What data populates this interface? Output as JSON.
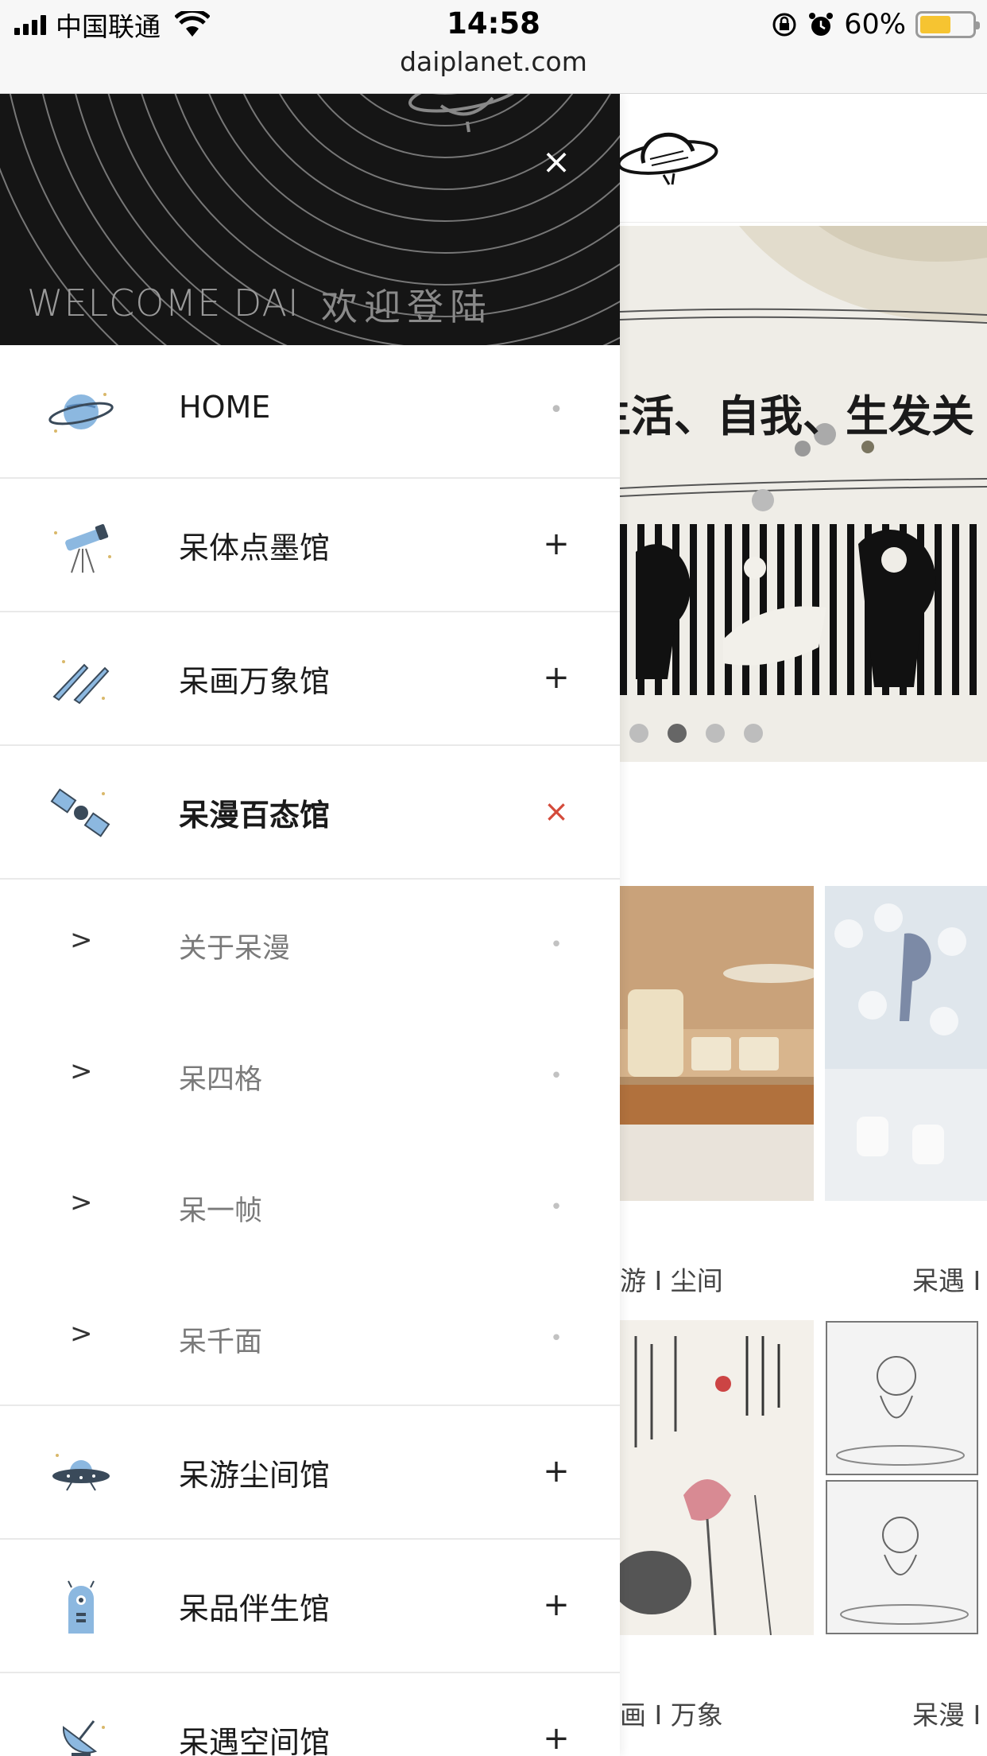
{
  "status_bar": {
    "carrier": "中国联通",
    "time": "14:58",
    "battery_percent": "60%",
    "battery_level": 0.6,
    "url": "daiplanet.com"
  },
  "drawer": {
    "welcome": "WELCOME DAI",
    "login": "欢迎登陆",
    "close_icon": "×",
    "items": [
      {
        "label": "HOME",
        "icon": "planet-icon",
        "action": "•"
      },
      {
        "label": "呆体点墨馆",
        "icon": "telescope-icon",
        "action": "+"
      },
      {
        "label": "呆画万象馆",
        "icon": "comet-icon",
        "action": "+"
      },
      {
        "label": "呆漫百态馆",
        "icon": "satellite-icon",
        "action": "×",
        "expanded": true
      },
      {
        "label": "呆游尘间馆",
        "icon": "ufo-icon",
        "action": "+"
      },
      {
        "label": "呆品伴生馆",
        "icon": "robot-icon",
        "action": "+"
      },
      {
        "label": "呆遇空间馆",
        "icon": "radar-dish-icon",
        "action": "+"
      }
    ],
    "subitems": [
      {
        "label": "关于呆漫",
        "chevron": ">",
        "action": "•"
      },
      {
        "label": "呆四格",
        "chevron": ">",
        "action": "•"
      },
      {
        "label": "呆一帧",
        "chevron": ">",
        "action": "•"
      },
      {
        "label": "呆千面",
        "chevron": ">",
        "action": "•"
      }
    ]
  },
  "page": {
    "banner_text": "生活、自我、生发关",
    "carousel_dots": 4,
    "carousel_active": 2,
    "captions": [
      "游 I 尘间",
      "呆遇 I",
      "画 I 万象",
      "呆漫 I"
    ]
  }
}
